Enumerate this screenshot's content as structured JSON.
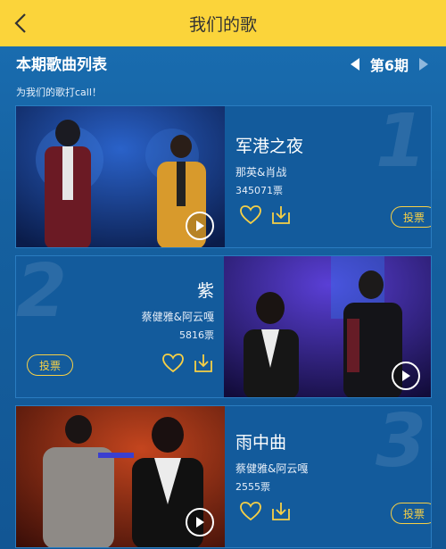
{
  "header": {
    "title": "我们的歌",
    "back_icon": "chevron-left-icon"
  },
  "section": {
    "title": "本期歌曲列表",
    "subtitle": "为我们的歌打call！"
  },
  "period": {
    "label": "第6期",
    "prev_icon": "triangle-left-icon",
    "next_icon": "triangle-right-icon"
  },
  "songs": [
    {
      "rank": "1",
      "title": "军港之夜",
      "artists": "那英&肖战",
      "votes": "345071票",
      "vote_label": "投票"
    },
    {
      "rank": "2",
      "title": "紫",
      "artists": "蔡健雅&阿云嘎",
      "votes": "5816票",
      "vote_label": "投票"
    },
    {
      "rank": "3",
      "title": "雨中曲",
      "artists": "蔡健雅&阿云嘎",
      "votes": "2555票",
      "vote_label": "投票"
    }
  ],
  "colors": {
    "header_bg": "#fbd43a",
    "accent": "#f7d046",
    "page_bg": "#1565a8"
  }
}
